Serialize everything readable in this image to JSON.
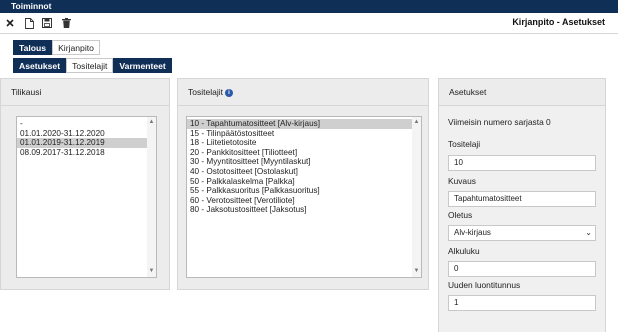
{
  "topbar": {
    "title": "Toiminnot"
  },
  "toolbar": {
    "icons": [
      "close-icon",
      "new-document-icon",
      "save-icon",
      "delete-icon"
    ],
    "page_title": "Kirjanpito - Asetukset"
  },
  "tabs_primary": [
    {
      "label": "Talous",
      "active": true
    },
    {
      "label": "Kirjanpito",
      "active": false
    }
  ],
  "tabs_secondary": [
    {
      "label": "Asetukset",
      "active": true
    },
    {
      "label": "Tositelajit",
      "active": false
    },
    {
      "label": "Varmenteet",
      "active": true
    }
  ],
  "tilikausi": {
    "header": "Tilikausi",
    "items": [
      "-",
      "01.01.2020-31.12.2020",
      "01.01.2019-31.12.2019",
      "08.09.2017-31.12.2018"
    ],
    "selected_index": 2
  },
  "tositelajit": {
    "header": "Tositelajit",
    "info_icon": "info-icon",
    "items": [
      "10 - Tapahtumatositteet [Alv-kirjaus]",
      "15 - Tilinpäätöstositteet",
      "18 - Liitetietotosite",
      "20 - Pankkitositteet [Tiliotteet]",
      "30 - Myyntitositteet [Myyntilaskut]",
      "40 - Ostotositteet [Ostolaskut]",
      "50 - Palkkalaskelma [Palkka]",
      "55 - Palkkasuoritus [Palkkasuoritus]",
      "60 - Verotositteet [Verotiliote]",
      "80 - Jaksotustositteet [Jaksotus]"
    ],
    "selected_index": 0
  },
  "asetukset": {
    "header": "Asetukset",
    "last_number_text": "Viimeisin numero sarjasta 0",
    "tositelaji_label": "Tositelaji",
    "tositelaji_value": "10",
    "kuvaus_label": "Kuvaus",
    "kuvaus_value": "Tapahtumatositteet",
    "oletus_label": "Oletus",
    "oletus_value": "Alv-kirjaus",
    "alkuluku_label": "Alkuluku",
    "alkuluku_value": "0",
    "uuden_label": "Uuden luontitunnus",
    "uuden_value": "1"
  },
  "colors": {
    "nav_dark": "#0f2f57",
    "panel_bg": "#ececec",
    "selection": "#cfcfcf"
  }
}
